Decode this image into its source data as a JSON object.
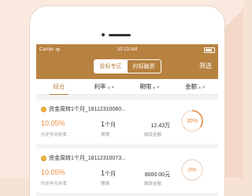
{
  "status_bar": {
    "carrier": "Carrier",
    "time": "10:13 AM"
  },
  "nav": {
    "tabs": [
      {
        "label": "投标专区",
        "active": true
      },
      {
        "label": "约标融资",
        "active": false
      }
    ],
    "filter_label": "筛选"
  },
  "sort_bar": {
    "columns": [
      {
        "label": "综合",
        "active": true,
        "sortable": false
      },
      {
        "label": "利率",
        "active": false,
        "sortable": true
      },
      {
        "label": "期限",
        "active": false,
        "sortable": true
      },
      {
        "label": "金额",
        "active": false,
        "sortable": true
      }
    ]
  },
  "products": [
    {
      "title": "资金周转1个月_18112310080...",
      "rate": "10.05%",
      "rate_label": "历史年化利率",
      "period_value": "1",
      "period_unit": "个月",
      "period_label": "期限",
      "amount": "12.43万",
      "amount_label": "融资金额",
      "progress": 35,
      "progress_text": "35%"
    },
    {
      "title": "资金周转1个月_18112310073...",
      "rate": "10.05%",
      "rate_label": "历史年化利率",
      "period_value": "1",
      "period_unit": "个月",
      "period_label": "期限",
      "amount": "8000.00元",
      "amount_label": "融资金额",
      "progress": 0,
      "progress_text": "0%"
    }
  ],
  "colors": {
    "accent": "#b7813f",
    "rate": "#e88b3f"
  }
}
